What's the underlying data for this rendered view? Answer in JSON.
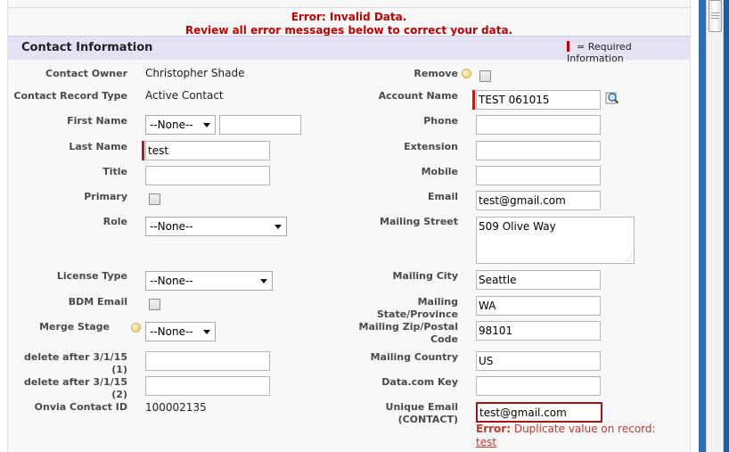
{
  "errors": {
    "line1": "Error: Invalid Data.",
    "line2": "Review all error messages below to correct your data."
  },
  "section": {
    "title": "Contact Information",
    "required_legend": "= Required Information"
  },
  "left_fields": {
    "contact_owner": {
      "label": "Contact Owner",
      "value": "Christopher Shade"
    },
    "record_type": {
      "label": "Contact Record Type",
      "value": "Active Contact"
    },
    "first_name": {
      "label": "First Name",
      "salutation": "--None--",
      "value": ""
    },
    "last_name": {
      "label": "Last Name",
      "value": "test"
    },
    "title": {
      "label": "Title",
      "value": ""
    },
    "primary": {
      "label": "Primary"
    },
    "role": {
      "label": "Role",
      "value": "--None--"
    },
    "license_type": {
      "label": "License Type",
      "value": "--None--"
    },
    "bdm_email": {
      "label": "BDM Email"
    },
    "merge_stage": {
      "label": "Merge Stage",
      "value": "--None--"
    },
    "delete1": {
      "label": "delete after 3/1/15 (1)",
      "value": ""
    },
    "delete2": {
      "label": "delete after 3/1/15 (2)",
      "value": ""
    },
    "onvia_id": {
      "label": "Onvia Contact ID",
      "value": "100002135"
    }
  },
  "right_fields": {
    "remove": {
      "label": "Remove"
    },
    "account_name": {
      "label": "Account Name",
      "value": "TEST 061015"
    },
    "phone": {
      "label": "Phone",
      "value": ""
    },
    "extension": {
      "label": "Extension",
      "value": ""
    },
    "mobile": {
      "label": "Mobile",
      "value": ""
    },
    "email": {
      "label": "Email",
      "value": "test@gmail.com"
    },
    "mailing_street": {
      "label": "Mailing Street",
      "value": "509 Olive Way"
    },
    "mailing_city": {
      "label": "Mailing City",
      "value": "Seattle"
    },
    "mailing_state": {
      "label": "Mailing State/Province",
      "value": "WA"
    },
    "mailing_zip": {
      "label_line1": "Mailing Zip/Postal",
      "label_line2": "Code",
      "value": "98101"
    },
    "mailing_country": {
      "label": "Mailing Country",
      "value": "US"
    },
    "datacom_key": {
      "label": "Data.com Key",
      "value": ""
    },
    "unique_email": {
      "label_line1": "Unique Email",
      "label_line2": "(CONTACT)",
      "value": "test@gmail.com",
      "error_prefix": "Error:",
      "error_text": "Duplicate value on record:",
      "error_link": "test"
    }
  },
  "icons": {
    "help": "info-bubble-icon",
    "lookup": "lookup-magnifier-icon"
  },
  "colors": {
    "error_red": "#c00000",
    "section_bg": "#e6e2f3",
    "required_bar": "#b71c1c",
    "scrollbar_blue": "#2b6fb3"
  }
}
